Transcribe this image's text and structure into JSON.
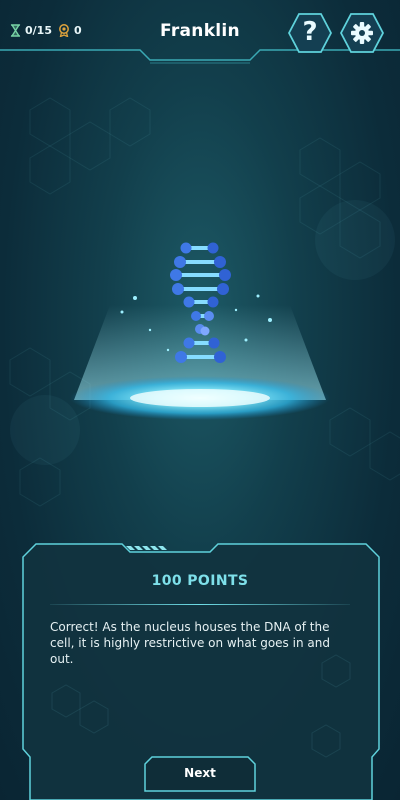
{
  "header": {
    "title": "Franklin",
    "tries": "0/15",
    "score": "0",
    "help_label": "?",
    "icons": {
      "tries": "hourglass-icon",
      "score": "medal-icon",
      "settings": "gear-icon"
    }
  },
  "result": {
    "points": "100 POINTS",
    "message": "Correct! As the nucleus houses the DNA of the cell, it is highly restrictive on what goes in and out."
  },
  "actions": {
    "next_label": "Next"
  },
  "colors": {
    "accent": "#7ee0ea",
    "frame": "#5fd2dc",
    "panel": "#11333f",
    "background": "#0c2c3a",
    "dna_blue": "#3d6fe0",
    "dna_light": "#7fd7ff"
  }
}
